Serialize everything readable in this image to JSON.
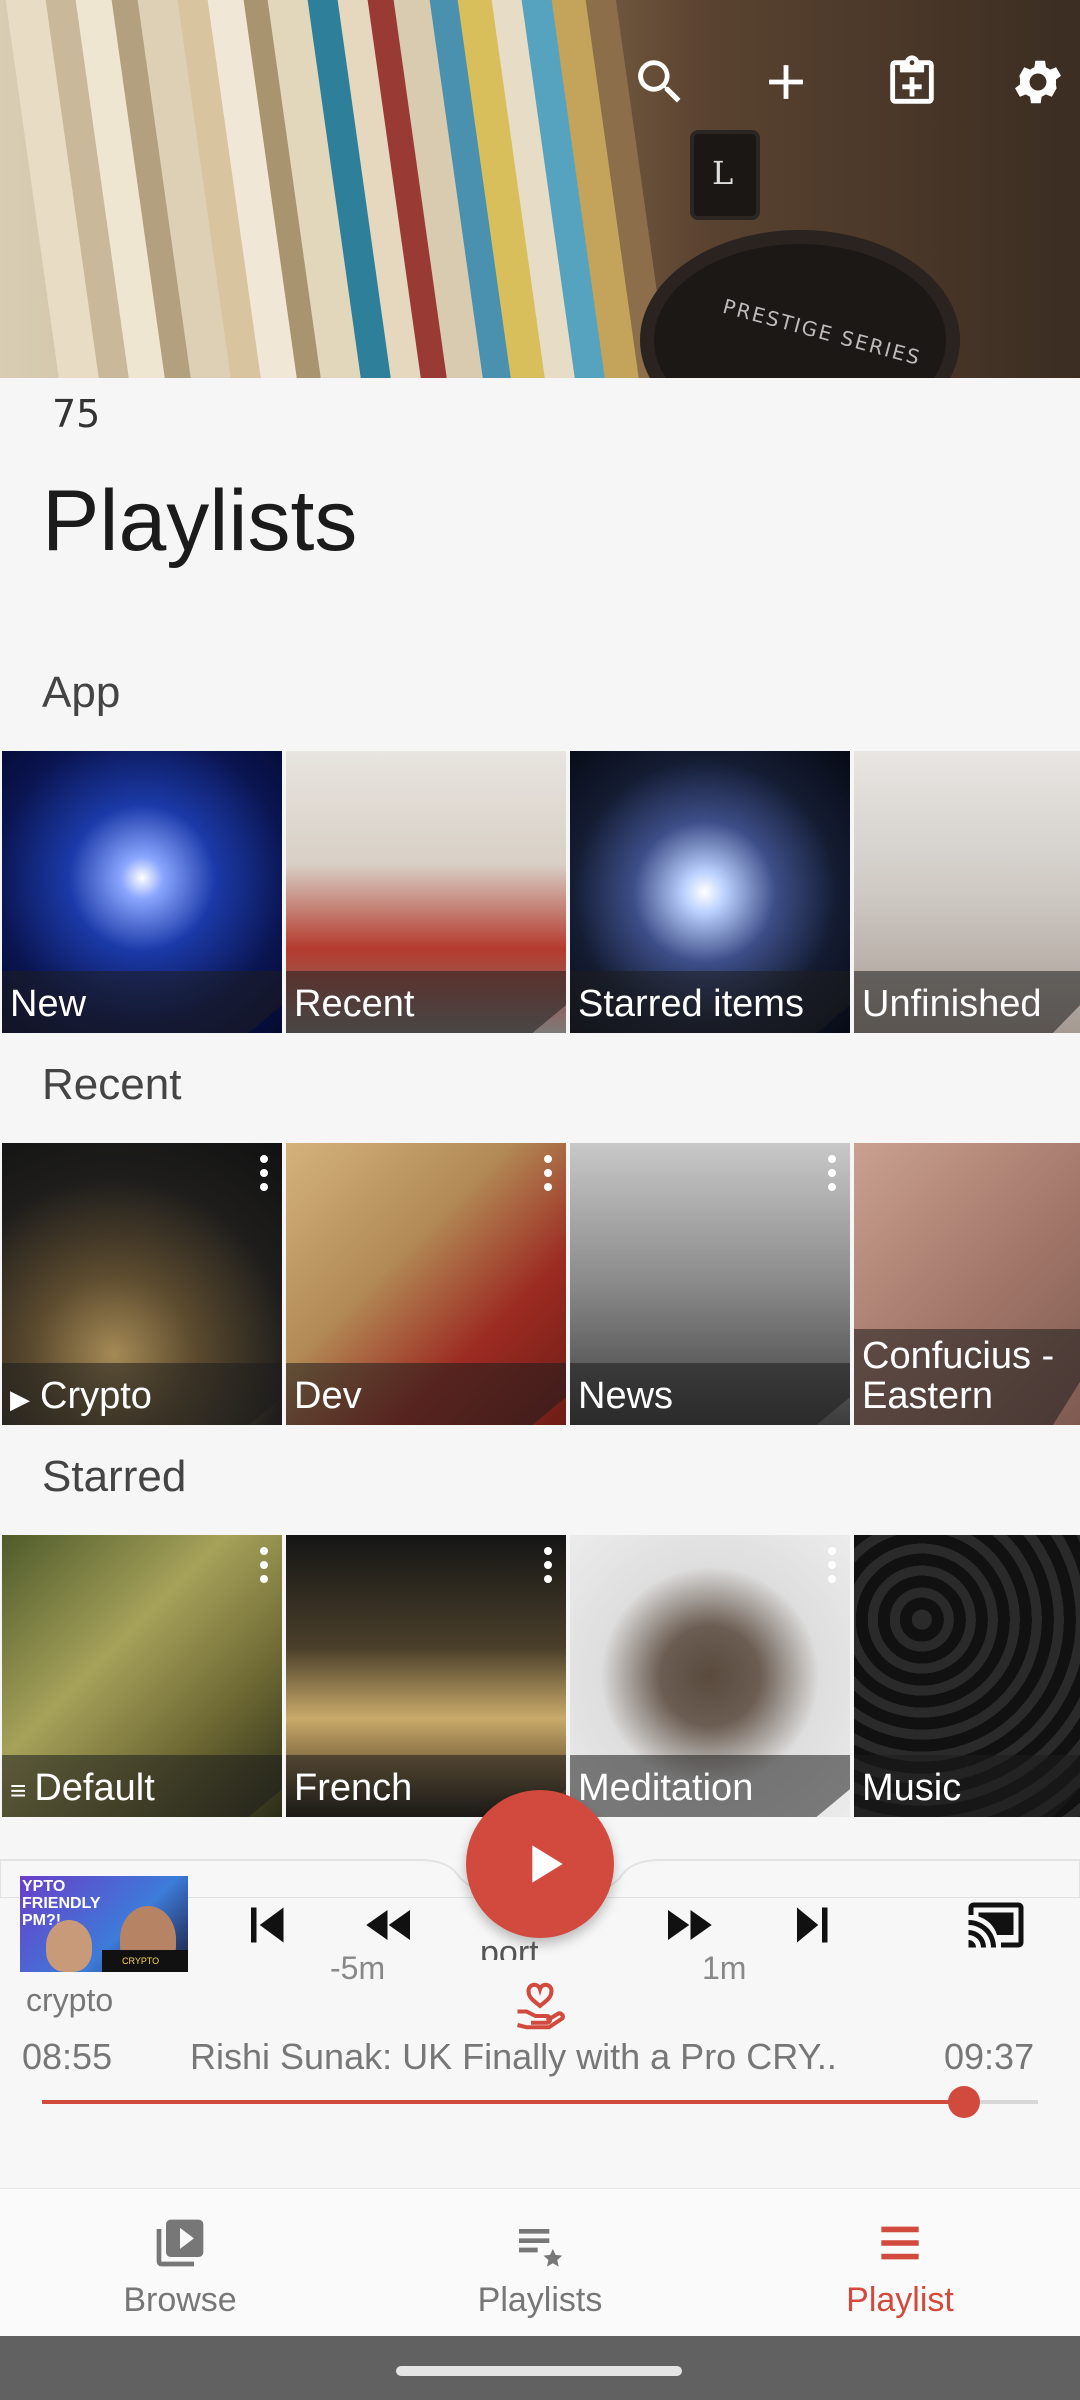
{
  "header": {
    "count": "75",
    "title": "Playlists"
  },
  "toolbar": {
    "icons": [
      "search-icon",
      "add-icon",
      "clipboard-add-icon",
      "settings-icon"
    ]
  },
  "sections": {
    "app": {
      "label": "App",
      "tiles": [
        "New",
        "Recent",
        "Starred items",
        "Unfinished"
      ]
    },
    "recent": {
      "label": "Recent",
      "tiles": [
        "Crypto",
        "Dev",
        "News",
        "Confucius - Eastern"
      ]
    },
    "starred": {
      "label": "Starred",
      "tiles": [
        "Default",
        "French",
        "Meditation",
        "Music"
      ]
    }
  },
  "player": {
    "thumbnail_text": "YPTO FRIENDLY PM?!",
    "thumbnail_badge": "CRYPTO",
    "rewind_label": "-5m",
    "forward_label": "1m",
    "partial_text": "port",
    "playlist_name": "crypto",
    "elapsed": "08:55",
    "title": "Rishi Sunak: UK Finally with a Pro CRY..",
    "duration": "09:37",
    "progress_fraction": 0.926
  },
  "bottom_nav": {
    "items": [
      {
        "label": "Browse",
        "icon": "video-library-icon",
        "active": false
      },
      {
        "label": "Playlists",
        "icon": "playlist-star-icon",
        "active": false
      },
      {
        "label": "Playlist",
        "icon": "menu-lines-icon",
        "active": true
      }
    ]
  },
  "colors": {
    "accent": "#d24a3d",
    "inactive": "#777777"
  }
}
